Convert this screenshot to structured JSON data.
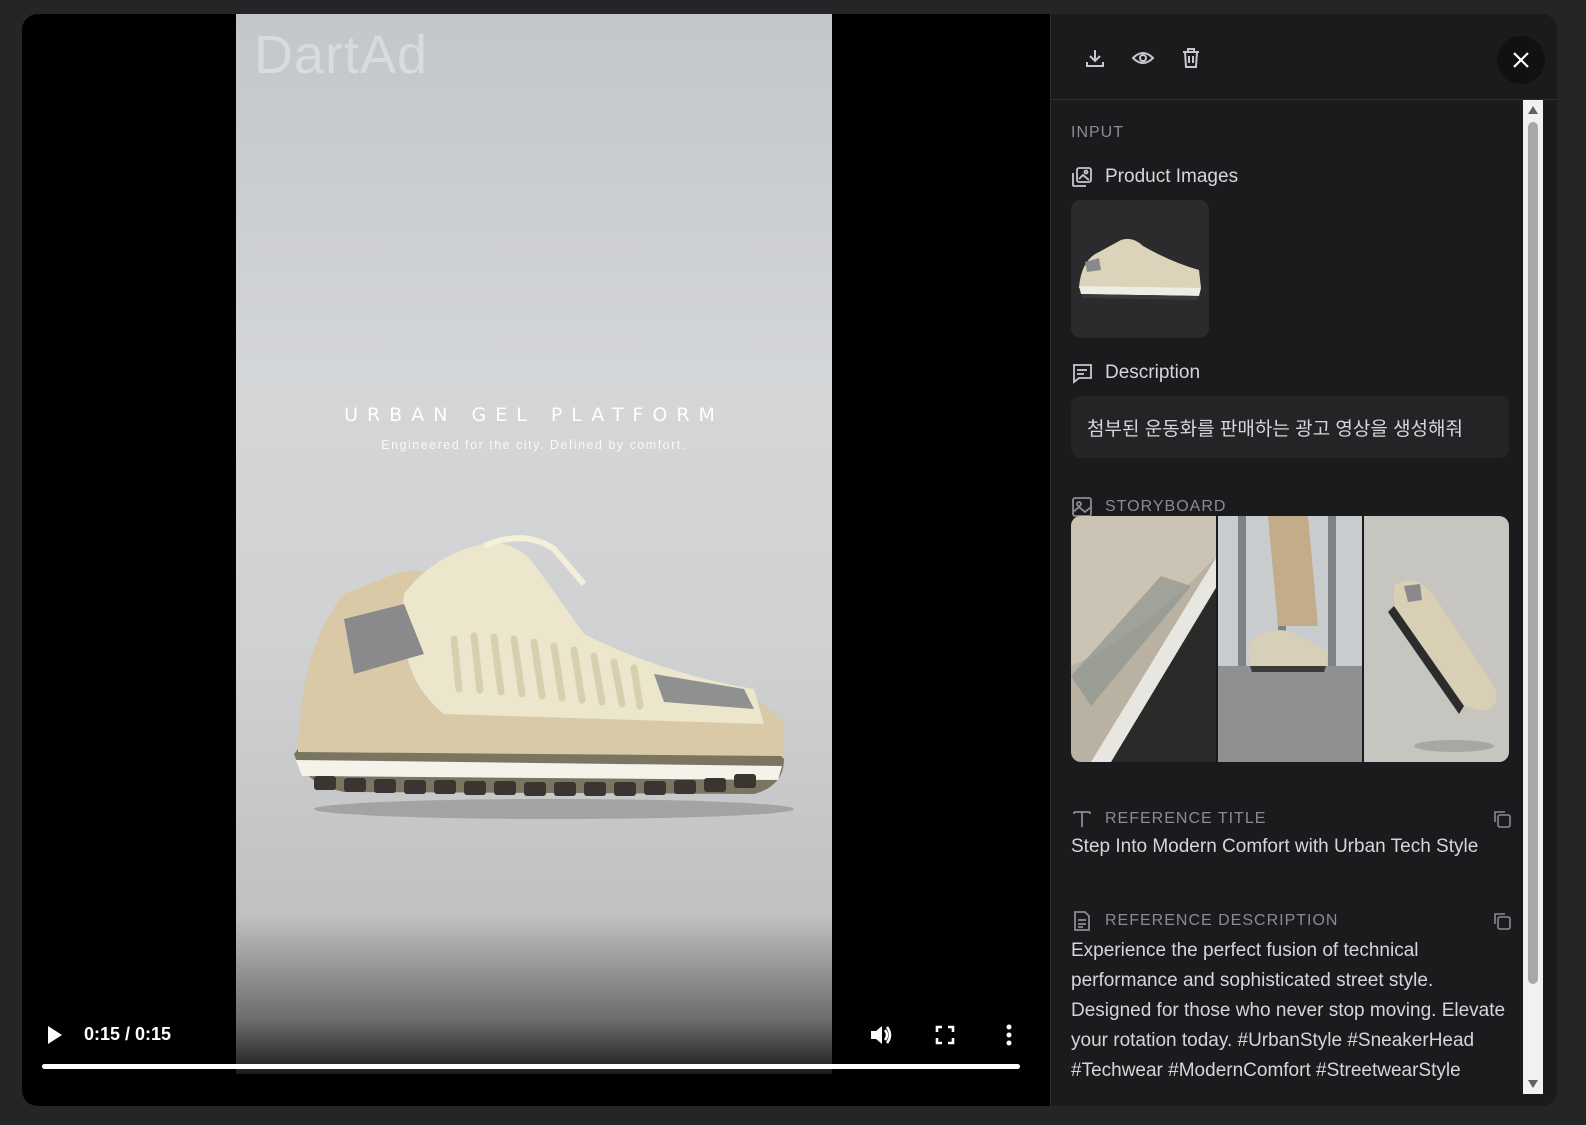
{
  "video": {
    "watermark": "DartAd",
    "ad_title": "URBAN GEL PLATFORM",
    "ad_subtitle": "Engineered for the city. Defined by comfort.",
    "time_display": "0:15 / 0:15",
    "progress_fraction": 1.0
  },
  "sidebar": {
    "input_label": "INPUT",
    "product_images_label": "Product Images",
    "description_label": "Description",
    "description_text": "첨부된 운동화를 판매하는 광고 영상을 생성해줘",
    "storyboard_label": "STORYBOARD",
    "reference_title_label": "REFERENCE TITLE",
    "reference_title_text": "Step Into Modern Comfort with Urban Tech Style",
    "reference_description_label": "REFERENCE DESCRIPTION",
    "reference_description_text": "Experience the perfect fusion of technical performance and sophisticated street style. Designed for those who never stop moving. Elevate your rotation today. #UrbanStyle #SneakerHead #Techwear #ModernComfort #StreetwearStyle"
  },
  "colors": {
    "panel_bg": "#1b1b1d",
    "modal_bg": "#161618",
    "text_primary": "#d6d6da",
    "text_muted": "#8b8b90"
  }
}
